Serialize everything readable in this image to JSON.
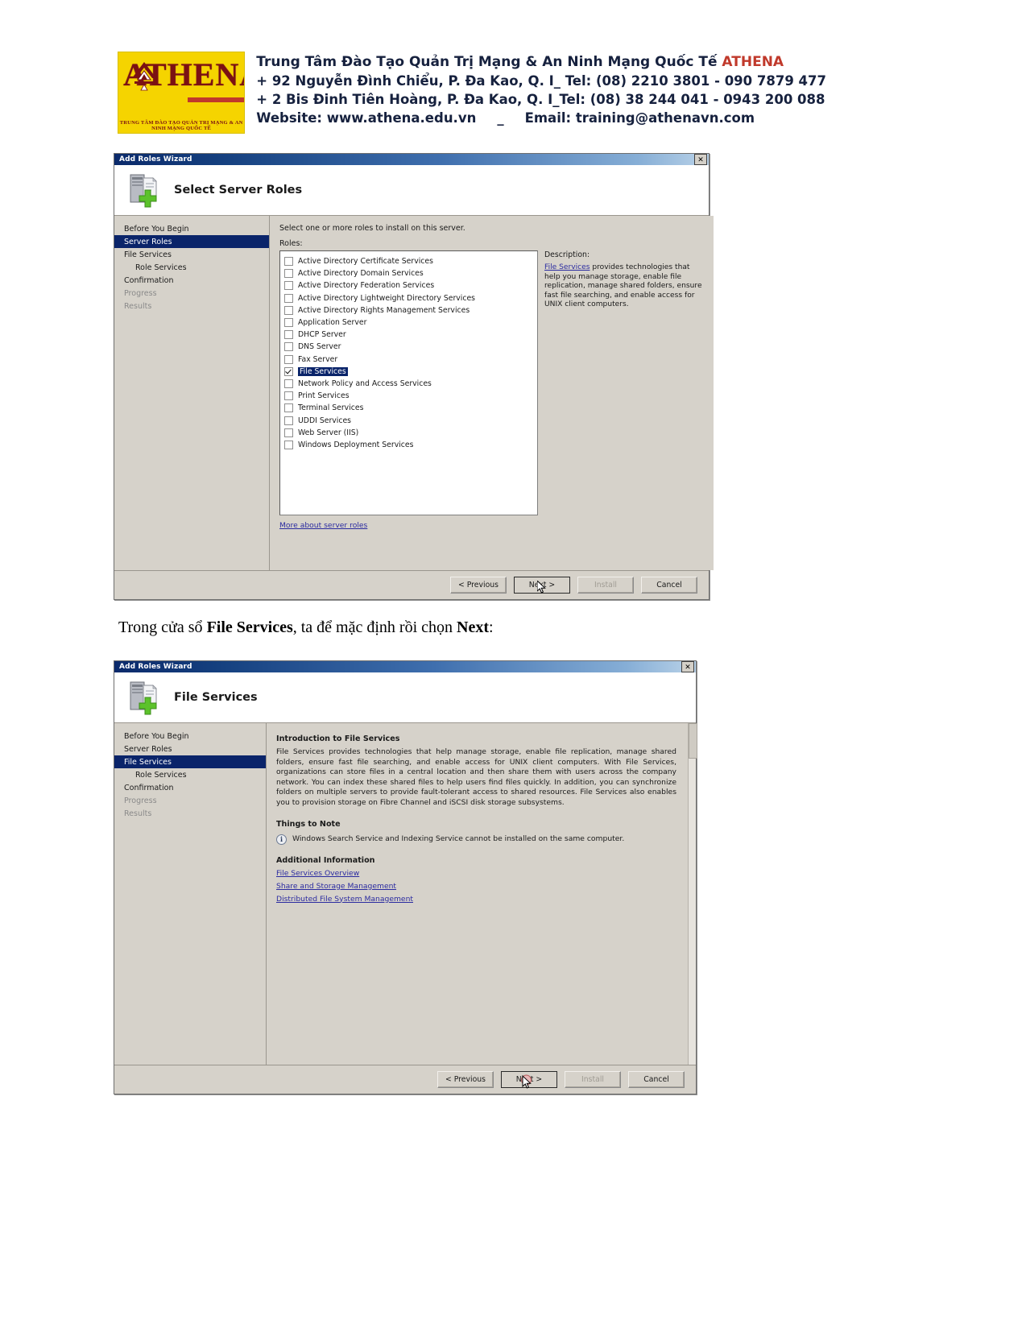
{
  "letterhead": {
    "logo_word": "ATHENA",
    "logo_tagline": "TRUNG TÂM ĐÀO TẠO QUẢN TRỊ MẠNG & AN NINH MẠNG QUỐC TẾ",
    "line1_main": "Trung Tâm Đào Tạo Quản Trị Mạng & An Ninh Mạng Quốc Tế ",
    "line1_accent": "ATHENA",
    "line2": "+ 92 Nguyễn Đình Chiểu, P. Đa Kao, Q. I_ Tel: (08) 2210 3801 -  090 7879 477",
    "line3": "+ 2 Bis Đinh Tiên Hoàng, P. Đa Kao, Q. I_Tel: (08) 38 244 041 - 0943 200 088",
    "line4_website": "Website: www.athena.edu.vn",
    "line4_sep": "_",
    "line4_email": "Email: training@athenavn.com"
  },
  "dialog1": {
    "window_title": "Add Roles Wizard",
    "close_label": "✕",
    "banner_title": "Select Server Roles",
    "nav": [
      {
        "label": "Before You Begin",
        "state": "normal",
        "indent": false
      },
      {
        "label": "Server Roles",
        "state": "selected",
        "indent": false
      },
      {
        "label": "File Services",
        "state": "normal",
        "indent": false
      },
      {
        "label": "Role Services",
        "state": "normal",
        "indent": true
      },
      {
        "label": "Confirmation",
        "state": "normal",
        "indent": false
      },
      {
        "label": "Progress",
        "state": "dim",
        "indent": false
      },
      {
        "label": "Results",
        "state": "dim",
        "indent": false
      }
    ],
    "lead": "Select one or more roles to install on this server.",
    "roles_label": "Roles:",
    "roles": [
      {
        "label": "Active Directory Certificate Services",
        "checked": false,
        "selected": false
      },
      {
        "label": "Active Directory Domain Services",
        "checked": false,
        "selected": false
      },
      {
        "label": "Active Directory Federation Services",
        "checked": false,
        "selected": false
      },
      {
        "label": "Active Directory Lightweight Directory Services",
        "checked": false,
        "selected": false
      },
      {
        "label": "Active Directory Rights Management Services",
        "checked": false,
        "selected": false
      },
      {
        "label": "Application Server",
        "checked": false,
        "selected": false
      },
      {
        "label": "DHCP Server",
        "checked": false,
        "selected": false
      },
      {
        "label": "DNS Server",
        "checked": false,
        "selected": false
      },
      {
        "label": "Fax Server",
        "checked": false,
        "selected": false
      },
      {
        "label": "File Services",
        "checked": true,
        "selected": true
      },
      {
        "label": "Network Policy and Access Services",
        "checked": false,
        "selected": false
      },
      {
        "label": "Print Services",
        "checked": false,
        "selected": false
      },
      {
        "label": "Terminal Services",
        "checked": false,
        "selected": false
      },
      {
        "label": "UDDI Services",
        "checked": false,
        "selected": false
      },
      {
        "label": "Web Server (IIS)",
        "checked": false,
        "selected": false
      },
      {
        "label": "Windows Deployment Services",
        "checked": false,
        "selected": false
      }
    ],
    "description_label": "Description:",
    "description_link": "File Services",
    "description_text": " provides technologies that help you manage storage, enable file replication, manage shared folders, ensure fast file searching, and enable access for UNIX client computers.",
    "more_link": "More about server roles",
    "buttons": {
      "previous": "< Previous",
      "next": "Next >",
      "install": "Install",
      "cancel": "Cancel"
    }
  },
  "caption": {
    "pre": "Trong cửa sổ ",
    "bold1": "File Services",
    "mid": ", ta để mặc định rồi chọn ",
    "bold2": "Next",
    "post": ":"
  },
  "dialog2": {
    "window_title": "Add Roles Wizard",
    "close_label": "✕",
    "banner_title": "File Services",
    "nav": [
      {
        "label": "Before You Begin",
        "state": "normal",
        "indent": false
      },
      {
        "label": "Server Roles",
        "state": "normal",
        "indent": false
      },
      {
        "label": "File Services",
        "state": "selected",
        "indent": false
      },
      {
        "label": "Role Services",
        "state": "normal",
        "indent": true
      },
      {
        "label": "Confirmation",
        "state": "normal",
        "indent": false
      },
      {
        "label": "Progress",
        "state": "dim",
        "indent": false
      },
      {
        "label": "Results",
        "state": "dim",
        "indent": false
      }
    ],
    "intro_heading": "Introduction to File Services",
    "intro_paragraph": "File Services provides technologies that help manage storage, enable file replication, manage shared folders, ensure fast file searching, and enable access for UNIX client computers. With File Services, organizations can store files in a central location and then share them with users across the company network. You can index these shared files to help users find files quickly. In addition, you can synchronize folders on multiple servers to provide fault-tolerant access to shared resources. File Services also enables you to provision storage on Fibre Channel and iSCSI disk storage subsystems.",
    "things_heading": "Things to Note",
    "note_icon": "i",
    "note_text": "Windows Search Service and Indexing Service cannot be installed on the same computer.",
    "additional_heading": "Additional Information",
    "links": [
      "File Services Overview",
      "Share and Storage Management",
      "Distributed File System Management"
    ],
    "buttons": {
      "previous": "< Previous",
      "next": "Next >",
      "install": "Install",
      "cancel": "Cancel"
    }
  },
  "colors": {
    "title_blue": "#0b2a6b",
    "selection_blue": "#0a246a",
    "dialog_face": "#d6d2ca",
    "link_blue": "#2b2ba0",
    "brand_yellow": "#f5d400",
    "brand_red": "#7b1113"
  }
}
